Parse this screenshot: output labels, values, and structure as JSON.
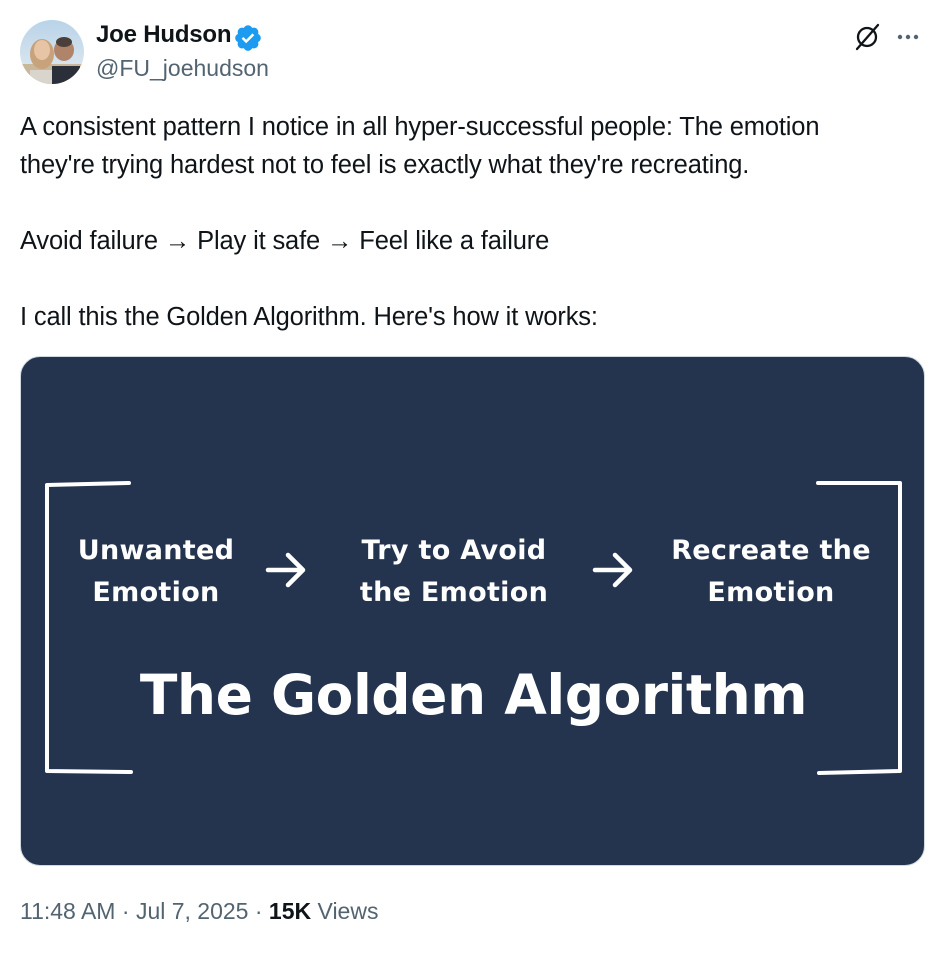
{
  "author": {
    "name": "Joe Hudson",
    "handle": "@FU_joehudson",
    "verified_color": "#1d9bf0"
  },
  "header_icons": {
    "grok": "grok-icon",
    "more": "more-icon"
  },
  "tweet": {
    "line1": "A consistent pattern I notice in all hyper-successful people: The emotion",
    "line2": "they're trying hardest not to feel is exactly what they're recreating.",
    "line3": "Avoid failure → Play it safe → Feel like a failure",
    "line4": "I call this the Golden Algorithm. Here's how it works:"
  },
  "media": {
    "background": "#24344f",
    "step1_line1": "Unwanted",
    "step1_line2": "Emotion",
    "step2_line1": "Try to Avoid",
    "step2_line2": "the Emotion",
    "step3_line1": "Recreate the",
    "step3_line2": "Emotion",
    "title": "The Golden Algorithm"
  },
  "meta": {
    "time": "11:48 AM",
    "date": "Jul 7, 2025",
    "separator": "·",
    "views_count": "15K",
    "views_label": "Views"
  }
}
